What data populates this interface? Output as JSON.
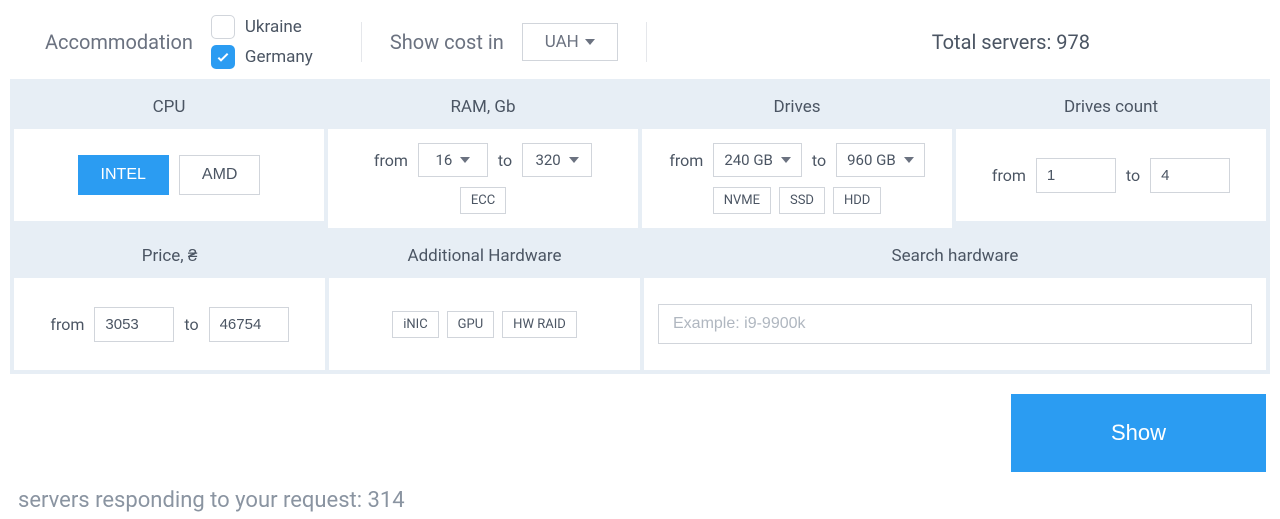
{
  "top": {
    "accommodation_label": "Accommodation",
    "locations": [
      {
        "label": "Ukraine",
        "checked": false
      },
      {
        "label": "Germany",
        "checked": true
      }
    ],
    "cost_label": "Show cost in",
    "currency": "UAH",
    "total_label": "Total servers:",
    "total_value": "978"
  },
  "filters": {
    "cpu": {
      "header": "CPU",
      "options": [
        "INTEL",
        "AMD"
      ],
      "active": "INTEL"
    },
    "ram": {
      "header": "RAM, Gb",
      "from_label": "from",
      "from_value": "16",
      "to_label": "to",
      "to_value": "320",
      "tags": [
        "ECC"
      ]
    },
    "drives": {
      "header": "Drives",
      "from_label": "from",
      "from_value": "240 GB",
      "to_label": "to",
      "to_value": "960 GB",
      "tags": [
        "NVME",
        "SSD",
        "HDD"
      ]
    },
    "drives_count": {
      "header": "Drives count",
      "from_label": "from",
      "from_value": "1",
      "to_label": "to",
      "to_value": "4"
    },
    "price": {
      "header": "Price, ₴",
      "from_label": "from",
      "from_value": "3053",
      "to_label": "to",
      "to_value": "46754"
    },
    "additional": {
      "header": "Additional Hardware",
      "tags": [
        "iNIC",
        "GPU",
        "HW RAID"
      ]
    },
    "search": {
      "header": "Search hardware",
      "placeholder": "Example: i9-9900k"
    }
  },
  "show_btn": "Show",
  "responding_label": "servers responding to your request:",
  "responding_value": "314"
}
